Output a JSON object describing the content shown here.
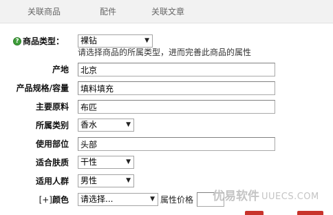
{
  "tabs": [
    {
      "label": "关联商品"
    },
    {
      "label": "配件"
    },
    {
      "label": "关联文章"
    }
  ],
  "icons": {
    "help": "help-icon",
    "help_glyph": "?",
    "dropdown": "chevron-down-icon",
    "dropdown_glyph": "▼"
  },
  "form": {
    "goods_type": {
      "label": "商品类型：",
      "value": "裸钻",
      "hint": "请选择商品的所属类型，进而完善此商品的属性"
    },
    "rows": [
      {
        "label": "产地",
        "type": "input",
        "value": "北京"
      },
      {
        "label": "产品规格/容量",
        "type": "input",
        "value": "填料填充"
      },
      {
        "label": "主要原料",
        "type": "input",
        "value": "布匹"
      },
      {
        "label": "所属类别",
        "type": "select",
        "value": "香水"
      },
      {
        "label": "使用部位",
        "type": "input",
        "value": "头部"
      },
      {
        "label": "适合肤质",
        "type": "select",
        "value": "干性"
      },
      {
        "label": "适用人群",
        "type": "select",
        "value": "男性"
      }
    ],
    "color": {
      "add_link": "[+]",
      "label": "颜色",
      "value": "请选择...",
      "price_label": "属性价格",
      "price_value": ""
    }
  },
  "watermark": {
    "brand": "优易软件",
    "site": "UUECS.COM"
  },
  "colors": {
    "tab_bar_bg": "#f2f2f2",
    "help_icon": "#3f9e3a",
    "button_red": "#c8332b"
  }
}
